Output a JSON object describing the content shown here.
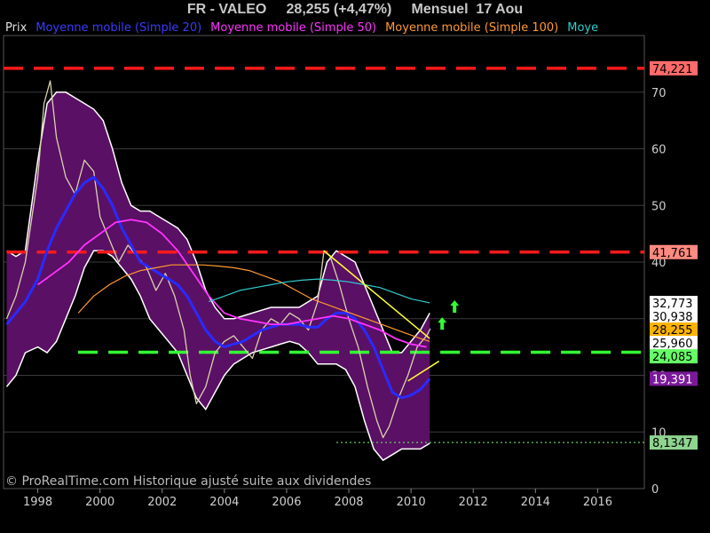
{
  "header": {
    "title": "FR - VALEO     28,255 (+4,47%)     Mensuel  17 Aou"
  },
  "legend": [
    {
      "label": "Prix",
      "color": "#e0e0e0"
    },
    {
      "label": "Moyenne mobile (Simple 20)",
      "color": "#3a3aff"
    },
    {
      "label": "Moyenne mobile (Simple 50)",
      "color": "#ff33ff"
    },
    {
      "label": "Moyenne mobile (Simple 100)",
      "color": "#ff9933"
    },
    {
      "label": "Moye",
      "color": "#33cccc"
    }
  ],
  "copyright": "© ProRealTime.com Historique ajusté suite aux dividendes",
  "chart_data": {
    "type": "line",
    "title": "FR - VALEO     28,255 (+4,47%)     Mensuel  17 Aou",
    "x_ticks": [
      "1998",
      "2000",
      "2002",
      "2004",
      "2006",
      "2008",
      "2010",
      "2012",
      "2014",
      "2016"
    ],
    "y_ticks": [
      "0",
      "10",
      "20",
      "30",
      "40",
      "50",
      "60",
      "70"
    ],
    "xlim": [
      1996.9,
      2017.5
    ],
    "ylim": [
      0,
      80
    ],
    "price_labels": [
      {
        "text": "74,221",
        "value": 74.221,
        "bg": "#ff6b6b",
        "fg": "#000000"
      },
      {
        "text": "41,761",
        "value": 41.761,
        "bg": "#ff8a80",
        "fg": "#000000"
      },
      {
        "text": "32,773",
        "value": 32.773,
        "bg": "#ffffff",
        "fg": "#000000"
      },
      {
        "text": "30,938",
        "value": 30.938,
        "bg": "#ffffff",
        "fg": "#000000"
      },
      {
        "text": "28,255",
        "value": 28.255,
        "bg": "#ffb300",
        "fg": "#000000"
      },
      {
        "text": "25,960",
        "value": 25.96,
        "bg": "#ffffff",
        "fg": "#000000"
      },
      {
        "text": "24,085",
        "value": 24.085,
        "bg": "#66ff66",
        "fg": "#000000"
      },
      {
        "text": "19,391",
        "value": 19.391,
        "bg": "#7a1a9a",
        "fg": "#ffffff"
      },
      {
        "text": "8,1347",
        "value": 8.1347,
        "bg": "#8fd48f",
        "fg": "#000000"
      }
    ],
    "horizontal_levels": [
      {
        "value": 74.221,
        "color": "#ff1a1a",
        "style": "dashed",
        "from_year": 1996.9
      },
      {
        "value": 41.761,
        "color": "#ff1a1a",
        "style": "dashed",
        "from_year": 1997.0
      },
      {
        "value": 24.085,
        "color": "#33ff33",
        "style": "dashed",
        "from_year": 1999.3
      },
      {
        "value": 8.1347,
        "color": "#66cc66",
        "style": "dotted",
        "from_year": 2007.6
      }
    ],
    "series": [
      {
        "name": "Prix",
        "color": "#d8d2b0",
        "x": [
          1997.0,
          1997.3,
          1997.6,
          1998.0,
          1998.2,
          1998.4,
          1998.6,
          1998.9,
          1999.2,
          1999.5,
          1999.8,
          2000.0,
          2000.3,
          2000.6,
          2000.9,
          2001.2,
          2001.5,
          2001.8,
          2002.1,
          2002.4,
          2002.7,
          2002.9,
          2003.1,
          2003.4,
          2003.7,
          2004.0,
          2004.3,
          2004.6,
          2004.9,
          2005.2,
          2005.5,
          2005.8,
          2006.1,
          2006.4,
          2006.7,
          2007.0,
          2007.2,
          2007.4,
          2007.7,
          2008.0,
          2008.3,
          2008.6,
          2008.9,
          2009.1,
          2009.3,
          2009.6,
          2009.9,
          2010.2,
          2010.5,
          2010.62
        ],
        "y": [
          30,
          34,
          40,
          55,
          68,
          72,
          62,
          55,
          52,
          58,
          56,
          48,
          44,
          40,
          43,
          41,
          39,
          35,
          38,
          34,
          28,
          20,
          15,
          18,
          24,
          26,
          27,
          25,
          23,
          28,
          30,
          29,
          31,
          30,
          28,
          33,
          42,
          41,
          36,
          30,
          25,
          18,
          12,
          9,
          11,
          16,
          20,
          25,
          27,
          28.255
        ]
      },
      {
        "name": "Moyenne mobile (Simple 20)",
        "color": "#2a2aff",
        "x": [
          1997.0,
          1997.3,
          1997.6,
          1998.0,
          1998.3,
          1998.6,
          1998.9,
          1999.2,
          1999.5,
          1999.8,
          2000.1,
          2000.4,
          2000.7,
          2001.0,
          2001.3,
          2001.6,
          2001.9,
          2002.2,
          2002.5,
          2002.8,
          2003.1,
          2003.4,
          2003.7,
          2004.0,
          2004.3,
          2004.6,
          2004.9,
          2005.2,
          2005.5,
          2005.8,
          2006.1,
          2006.4,
          2006.7,
          2007.0,
          2007.3,
          2007.6,
          2007.9,
          2008.2,
          2008.5,
          2008.8,
          2009.1,
          2009.4,
          2009.7,
          2010.0,
          2010.3,
          2010.6
        ],
        "y": [
          29,
          31,
          33,
          37,
          42,
          46,
          49,
          52,
          54,
          55,
          53,
          50,
          46,
          43,
          40,
          39,
          38,
          37,
          36,
          34,
          31,
          28,
          26,
          25,
          25.5,
          26,
          27,
          28,
          28.5,
          29,
          29,
          29,
          28.5,
          28.5,
          30,
          31,
          31,
          30,
          28,
          25,
          21,
          17,
          16,
          16.5,
          17.5,
          19.4
        ]
      },
      {
        "name": "Moyenne mobile (Simple 50)",
        "color": "#ff33ff",
        "x": [
          1998.0,
          1998.5,
          1999.0,
          1999.5,
          2000.0,
          2000.5,
          2001.0,
          2001.5,
          2002.0,
          2002.5,
          2003.0,
          2003.5,
          2004.0,
          2004.5,
          2005.0,
          2005.5,
          2006.0,
          2006.5,
          2007.0,
          2007.5,
          2008.0,
          2008.5,
          2009.0,
          2009.5,
          2010.0,
          2010.5
        ],
        "y": [
          36,
          38,
          40,
          43,
          45,
          47,
          47.5,
          47,
          45,
          42,
          38,
          34,
          31,
          30,
          29.5,
          29,
          29,
          29.5,
          30,
          30.5,
          30,
          29,
          28,
          26.5,
          25.5,
          25
        ]
      },
      {
        "name": "Moyenne mobile (Simple 100)",
        "color": "#ff9933",
        "x": [
          1999.3,
          1999.8,
          2000.3,
          2000.8,
          2001.3,
          2001.8,
          2002.3,
          2002.8,
          2003.3,
          2003.8,
          2004.3,
          2004.8,
          2005.3,
          2005.8,
          2006.3,
          2006.8,
          2007.3,
          2007.8,
          2008.3,
          2008.8,
          2009.3,
          2009.8,
          2010.3,
          2010.6
        ],
        "y": [
          31,
          34,
          36,
          37.5,
          38.5,
          39,
          39.5,
          39.5,
          39.5,
          39.3,
          39,
          38.5,
          37.5,
          36.5,
          35,
          33.5,
          32.5,
          31.5,
          30.5,
          29.5,
          28.5,
          27.5,
          26.5,
          26
        ]
      },
      {
        "name": "Moye",
        "color": "#33cccc",
        "x": [
          2003.5,
          2004.0,
          2004.5,
          2005.0,
          2005.5,
          2006.0,
          2006.5,
          2007.0,
          2007.5,
          2008.0,
          2008.5,
          2009.0,
          2009.5,
          2010.0,
          2010.6
        ],
        "y": [
          33,
          34,
          35,
          35.5,
          36,
          36.5,
          36.8,
          37,
          36.8,
          36.5,
          36,
          35.5,
          34.5,
          33.5,
          32.8
        ]
      }
    ],
    "bollinger": {
      "color": "#ffffff",
      "fill": "#5a1064",
      "x": [
        1997.0,
        1997.3,
        1997.6,
        1998.0,
        1998.3,
        1998.6,
        1998.9,
        1999.2,
        1999.5,
        1999.8,
        2000.1,
        2000.4,
        2000.7,
        2001.0,
        2001.3,
        2001.6,
        2001.9,
        2002.2,
        2002.5,
        2002.8,
        2003.1,
        2003.4,
        2003.7,
        2004.0,
        2004.3,
        2004.6,
        2004.9,
        2005.2,
        2005.5,
        2005.8,
        2006.1,
        2006.4,
        2006.7,
        2007.0,
        2007.3,
        2007.6,
        2007.9,
        2008.2,
        2008.5,
        2008.8,
        2009.1,
        2009.4,
        2009.7,
        2010.0,
        2010.3,
        2010.6
      ],
      "upper": [
        42,
        41,
        42,
        58,
        68,
        70,
        70,
        69,
        68,
        67,
        65,
        60,
        54,
        50,
        49,
        49,
        48,
        47,
        46,
        44,
        40,
        35,
        32,
        30,
        30,
        30.5,
        31,
        31.5,
        32,
        32,
        32,
        32,
        33,
        34,
        40,
        42,
        41,
        40,
        36,
        32,
        28,
        24,
        24,
        26,
        28,
        31
      ],
      "lower": [
        18,
        20,
        24,
        25,
        24,
        26,
        30,
        34,
        39,
        42,
        42,
        41,
        39,
        37,
        34,
        30,
        28,
        26,
        24,
        20,
        16,
        14,
        17,
        20,
        22,
        23,
        24,
        24.5,
        25,
        25.5,
        26,
        25.5,
        24,
        22,
        22,
        22,
        21,
        18,
        12,
        7,
        5,
        6,
        7,
        7,
        7,
        8
      ]
    },
    "trendlines": [
      {
        "x": [
          2007.2,
          2010.6
        ],
        "y": [
          42,
          26.5
        ],
        "color": "#ffff33"
      },
      {
        "x": [
          2009.9,
          2010.9
        ],
        "y": [
          19,
          22.5
        ],
        "color": "#ffff33"
      }
    ],
    "arrows": [
      {
        "x": 2011.0,
        "y": 29,
        "color": "#33ff33"
      },
      {
        "x": 2011.4,
        "y": 32,
        "color": "#33ff33"
      }
    ]
  }
}
